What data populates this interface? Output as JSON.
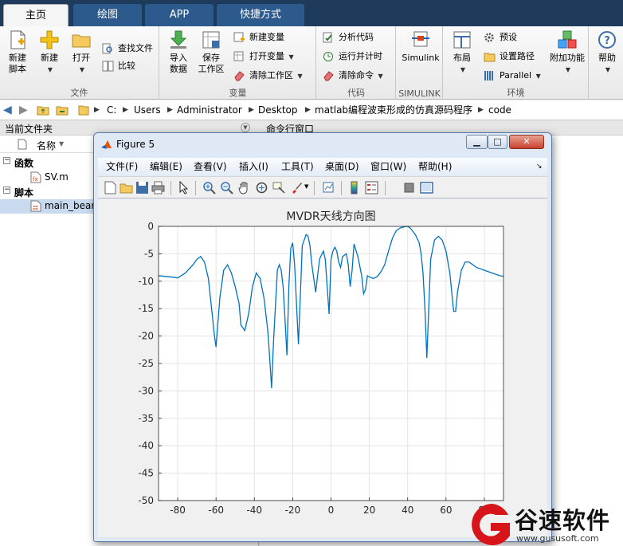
{
  "ribbon_tabs": [
    "主页",
    "绘图",
    "APP",
    "快捷方式"
  ],
  "ribbon": {
    "file": {
      "new_script": "新建\n脚本",
      "new": "新建",
      "open": "打开",
      "find_files": "查找文件",
      "compare": "比较",
      "label": "文件"
    },
    "variable": {
      "import_data": "导入\n数据",
      "save_workspace": "保存\n工作区",
      "new_variable": "新建变量",
      "open_variable": "打开变量",
      "clear_workspace": "清除工作区",
      "label": "变量"
    },
    "code": {
      "analyze_code": "分析代码",
      "run_and_time": "运行并计时",
      "clear_commands": "清除命令",
      "label": "代码"
    },
    "simulink": {
      "simulink": "Simulink",
      "label": "SIMULINK"
    },
    "environment": {
      "layout": "布局",
      "preferences": "预设",
      "set_path": "设置路径",
      "parallel": "Parallel",
      "addons": "附加功能",
      "label": "环境"
    },
    "resources": {
      "help": "帮助"
    }
  },
  "address": {
    "crumbs": [
      "C:",
      "Users",
      "Administrator",
      "Desktop",
      "matlab编程波束形成的仿真源码程序",
      "code"
    ]
  },
  "panels": {
    "current_folder_title": "当前文件夹",
    "command_window_title": "命令行窗口"
  },
  "file_browser": {
    "column_name": "名称",
    "groups": [
      {
        "label": "函数",
        "items": [
          "SV.m"
        ]
      },
      {
        "label": "脚本",
        "items": [
          "main_bean"
        ]
      }
    ]
  },
  "figure": {
    "title": "Figure 5",
    "menus": [
      "文件(F)",
      "编辑(E)",
      "查看(V)",
      "插入(I)",
      "工具(T)",
      "桌面(D)",
      "窗口(W)",
      "帮助(H)"
    ]
  },
  "watermark": {
    "brand": "谷速软件",
    "url": "www.gususoft.com"
  },
  "colors": {
    "line": "#0072bd",
    "ribbon_dark": "#1f3b5c",
    "watermark_red": "#d7141a"
  },
  "chart_data": {
    "type": "line",
    "title": "MVDR天线方向图",
    "xlabel": "",
    "ylabel": "",
    "xlim": [
      -90,
      90
    ],
    "ylim": [
      -50,
      0
    ],
    "xticks": [
      -80,
      -60,
      -40,
      -20,
      0,
      20,
      40,
      60,
      80
    ],
    "yticks": [
      0,
      -5,
      -10,
      -15,
      -20,
      -25,
      -30,
      -35,
      -40,
      -45,
      -50
    ],
    "grid": true,
    "series": [
      {
        "x": [
          -90,
          -84,
          -80,
          -76,
          -72,
          -70,
          -68,
          -66,
          -64,
          -62,
          -61,
          -60,
          -58,
          -56,
          -54,
          -52,
          -50,
          -48,
          -47,
          -45,
          -43,
          -41,
          -39,
          -37,
          -35,
          -33,
          -32,
          -31,
          -30,
          -28,
          -27,
          -26,
          -25,
          -24,
          -23,
          -22,
          -21,
          -20,
          -19,
          -17,
          -15,
          -13,
          -12,
          -11,
          -10,
          -8,
          -6,
          -4,
          -3,
          -2,
          -1,
          0,
          1,
          2,
          3,
          4,
          5,
          6,
          8,
          9,
          10,
          11,
          12,
          14,
          16,
          17,
          18,
          19,
          20,
          22,
          24,
          26,
          28,
          30,
          32,
          34,
          36,
          38,
          39,
          40,
          41,
          42,
          44,
          46,
          47,
          48,
          49,
          50,
          51,
          52,
          54,
          56,
          58,
          60,
          62,
          63,
          64,
          65,
          66,
          68,
          70,
          72,
          74,
          76,
          80,
          84,
          88,
          90
        ],
        "y": [
          -9.0,
          -9.2,
          -9.4,
          -8.5,
          -7.0,
          -6.0,
          -5.5,
          -6.5,
          -9.5,
          -16.0,
          -19.5,
          -22.0,
          -13.0,
          -8.0,
          -7.0,
          -8.5,
          -11.0,
          -14.0,
          -18.0,
          -19.0,
          -16.0,
          -11.0,
          -8.5,
          -9.5,
          -13.0,
          -19.0,
          -24.0,
          -29.5,
          -21.0,
          -8.0,
          -7.0,
          -8.0,
          -11.0,
          -17.0,
          -23.5,
          -11.0,
          -4.0,
          -3.0,
          -7.0,
          -21.5,
          -3.5,
          -1.5,
          -1.8,
          -3.5,
          -7.0,
          -12.0,
          -6.0,
          -4.5,
          -6.0,
          -11.0,
          -16.0,
          -6.0,
          -4.5,
          -3.8,
          -4.5,
          -6.5,
          -7.5,
          -5.5,
          -5.0,
          -7.0,
          -11.0,
          -8.0,
          -3.2,
          -5.5,
          -9.0,
          -12.3,
          -11.5,
          -9.0,
          -9.2,
          -9.5,
          -9.2,
          -8.3,
          -7.0,
          -4.5,
          -2.2,
          -0.8,
          -0.3,
          -0.1,
          -0.02,
          0.0,
          -0.2,
          -0.6,
          -1.5,
          -3.0,
          -5.0,
          -8.5,
          -15.0,
          -24.0,
          -15.0,
          -6.0,
          -2.5,
          -1.8,
          -2.5,
          -4.5,
          -8.5,
          -12.0,
          -15.5,
          -15.5,
          -12.0,
          -8.0,
          -6.5,
          -6.5,
          -7.0,
          -7.5,
          -8.0,
          -8.5,
          -9.0,
          -9.1
        ]
      }
    ]
  }
}
